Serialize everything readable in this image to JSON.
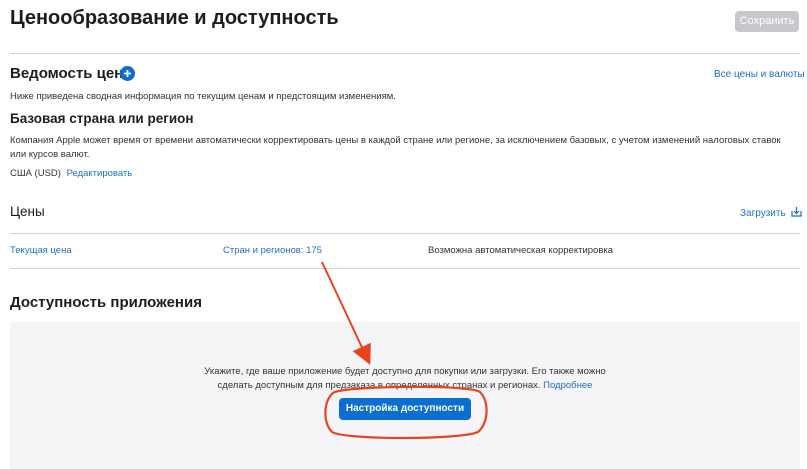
{
  "header": {
    "title": "Ценообразование и доступность",
    "save_label": "Сохранить"
  },
  "price_schedule": {
    "title": "Ведомость цен",
    "all_prices_link": "Все цены и валюты",
    "description": "Ниже приведена сводная информация по текущим ценам и предстоящим изменениям."
  },
  "base_country": {
    "title": "Базовая страна или регион",
    "description_line1": "Компания Apple может время от времени автоматически корректировать цены в каждой стране или регионе, за исключением базовых, с учетом изменений налоговых ставок",
    "description_line2": "или курсов валют.",
    "currency": "США (USD)",
    "edit_link": "Редактировать"
  },
  "prices": {
    "title": "Цены",
    "upload_label": "Загрузить",
    "row": {
      "current_price": "Текущая цена",
      "countries": "Стран и регионов: 175",
      "auto_adjust": "Возможна автоматическая корректировка"
    }
  },
  "availability": {
    "title": "Доступность приложения",
    "text_line1": "Укажите, где ваше приложение будет доступно для покупки или загрузки. Его также можно",
    "text_line2": "сделать доступным для предзаказа в определенных странах и регионах.",
    "more_link": "Подробнее",
    "setup_button": "Настройка доступности"
  },
  "colors": {
    "accent": "#0a6fd1",
    "link": "#1f6fc4",
    "annotation": "#e8431f"
  }
}
